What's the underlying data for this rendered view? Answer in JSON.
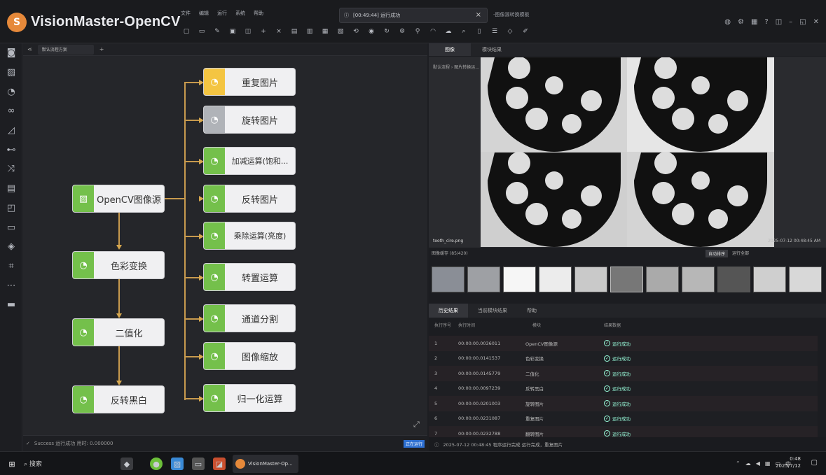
{
  "app": {
    "title": "VisionMaster-OpenCV",
    "logo_glyph": "S"
  },
  "menu": [
    "文件",
    "编辑",
    "运行",
    "系统",
    "帮助"
  ],
  "notice": {
    "text": "[00:49:44] 运行成功",
    "tail": "-图像源转换模板"
  },
  "canvas": {
    "tab_label": "默认流程方案",
    "status": "Success 运行成功 用时: 0.000000",
    "status_badge": "正在运行",
    "source_node": "OpenCV图像源",
    "main_chain": [
      "色彩变换",
      "二值化",
      "反转黑白"
    ],
    "branch_nodes": [
      "重复图片",
      "旋转图片",
      "加减运算(饱和...",
      "反转图片",
      "乘除运算(亮度)",
      "转置运算",
      "通道分割",
      "图像缩放",
      "归一化运算"
    ]
  },
  "right": {
    "tabs": [
      "图像",
      "模块结果"
    ],
    "image_path": "默认流程 › 图片转换运...",
    "image_caption": "tooth_cire.png",
    "image_time": "2025-07-12 00:48:45 AM",
    "thumb_header": "图像缓存 (85/420)",
    "thumb_btn": "自动排序",
    "thumb_btn2": "运行全部",
    "lower_tabs": [
      "历史结果",
      "当前模块结果",
      "帮助"
    ],
    "table_headers": [
      "执行序号",
      "执行时间",
      "模块",
      "结果数据"
    ],
    "rows": [
      {
        "n": "1",
        "t": "00:00:00.0036011",
        "m": "OpenCV图像源",
        "r": "运行成功"
      },
      {
        "n": "2",
        "t": "00:00:00.0141537",
        "m": "色彩变换",
        "r": "运行成功"
      },
      {
        "n": "3",
        "t": "00:00:00.0145779",
        "m": "二值化",
        "r": "运行成功"
      },
      {
        "n": "4",
        "t": "00:00:00.0097239",
        "m": "反转黑白",
        "r": "运行成功"
      },
      {
        "n": "5",
        "t": "00:00:00.0201003",
        "m": "旋转图片",
        "r": "运行成功"
      },
      {
        "n": "6",
        "t": "00:00:00.0231087",
        "m": "重复图片",
        "r": "运行成功"
      },
      {
        "n": "7",
        "t": "00:00:00.0232788",
        "m": "翻转图片",
        "r": "运行成功"
      }
    ],
    "footer": "2025-07-12 00:48:45  程序运行完成 运行完成，重复图片"
  },
  "taskbar": {
    "search": "搜索",
    "task_label": "VisionMaster-Op...",
    "time": "0:48",
    "date": "2025/7/12"
  }
}
